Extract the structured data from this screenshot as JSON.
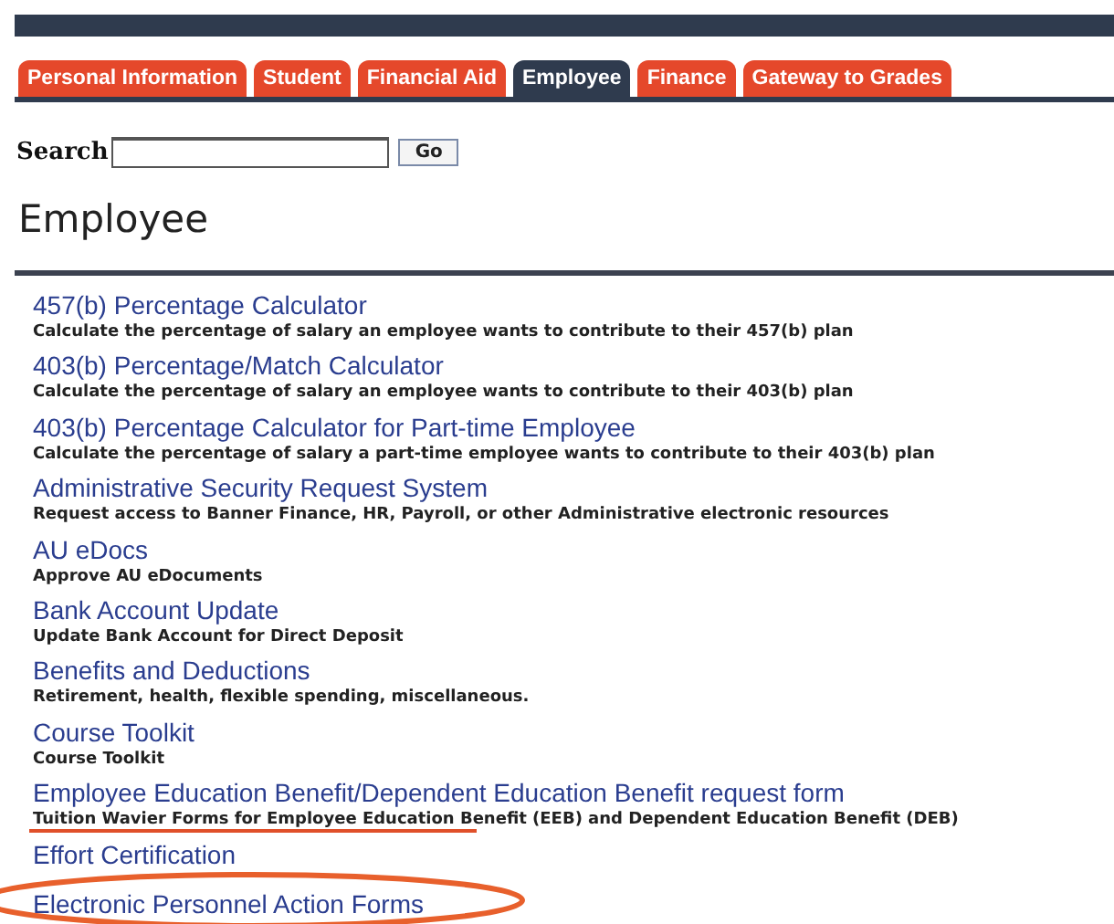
{
  "tabs": [
    {
      "label": "Personal Information",
      "selected": false
    },
    {
      "label": "Student",
      "selected": false
    },
    {
      "label": "Financial Aid",
      "selected": false
    },
    {
      "label": "Employee",
      "selected": true
    },
    {
      "label": "Finance",
      "selected": false
    },
    {
      "label": "Gateway to Grades",
      "selected": false
    }
  ],
  "search": {
    "label": "Search",
    "button": "Go"
  },
  "heading": "Employee",
  "items": [
    {
      "title": "457(b) Percentage Calculator",
      "description": "Calculate the percentage of salary an employee wants to contribute to their 457(b) plan"
    },
    {
      "title": "403(b) Percentage/Match Calculator",
      "description": "Calculate the percentage of salary an employee wants to contribute to their 403(b) plan"
    },
    {
      "title": "403(b) Percentage Calculator for Part-time Employee",
      "description": "Calculate the percentage of salary a part-time employee wants to contribute to their 403(b) plan"
    },
    {
      "title": "Administrative Security Request System",
      "description": "Request access to Banner Finance, HR, Payroll, or other Administrative electronic resources"
    },
    {
      "title": "AU eDocs",
      "description": "Approve AU eDocuments"
    },
    {
      "title": "Bank Account Update",
      "description": "Update Bank Account for Direct Deposit"
    },
    {
      "title": "Benefits and Deductions",
      "description": "Retirement, health, flexible spending, miscellaneous."
    },
    {
      "title": "Course Toolkit",
      "description": "Course Toolkit"
    },
    {
      "title": "Employee Education Benefit/Dependent Education Benefit request form",
      "description": "Tuition Wavier Forms for Employee Education Benefit (EEB) and Dependent Education Benefit (DEB)",
      "underlined": true
    },
    {
      "title": "Effort Certification"
    },
    {
      "title": "Electronic Personnel Action Forms",
      "circled": true
    }
  ]
}
